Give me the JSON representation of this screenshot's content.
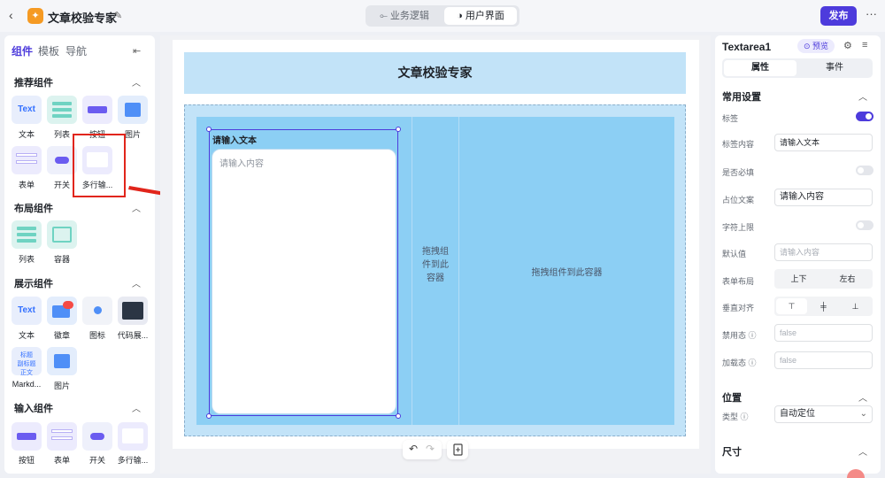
{
  "header": {
    "back_icon": "chevron-left-icon",
    "title": "文章校验专家",
    "modes": [
      "业务逻辑",
      "用户界面"
    ],
    "active_mode": "用户界面",
    "publish_label": "发布",
    "more_icon": "more-icon"
  },
  "left_panel": {
    "tabs": [
      "组件",
      "模板",
      "导航"
    ],
    "active_tab": "组件",
    "sections": {
      "recommended": {
        "title": "推荐组件",
        "items": [
          "文本",
          "列表",
          "按钮",
          "图片",
          "表单",
          "开关",
          "多行输..."
        ]
      },
      "layout": {
        "title": "布局组件",
        "items": [
          "列表",
          "容器"
        ]
      },
      "display": {
        "title": "展示组件",
        "items": [
          "文本",
          "徽章",
          "图标",
          "代码展...",
          "Markd...",
          "图片"
        ]
      },
      "input": {
        "title": "输入组件",
        "items": [
          "按钮",
          "表单",
          "开关",
          "多行输..."
        ]
      }
    },
    "tile_text": {
      "text": "Text",
      "badge": "99",
      "md": "标题\n副标题\n正文内容"
    }
  },
  "canvas": {
    "page_title": "文章校验专家",
    "textarea_label": "请输入文本",
    "textarea_placeholder": "请输入内容",
    "drop_hint_narrow": "拖拽组件到此容器",
    "drop_hint_wide": "拖拽组件到此容器"
  },
  "right_panel": {
    "component_name": "Textarea1",
    "preview_label": "预览",
    "tabs": [
      "属性",
      "事件"
    ],
    "active_tab": "属性",
    "sec_common": "常用设置",
    "labels": {
      "label": "标签",
      "label_content": "标签内容",
      "required": "是否必填",
      "placeholder": "占位文案",
      "maxlength": "字符上限",
      "default": "默认值",
      "form_layout": "表单布局",
      "v_align": "垂直对齐",
      "disabled": "禁用态",
      "loading": "加载态"
    },
    "values": {
      "label_content": "请输入文本",
      "placeholder": "请输入内容",
      "default_placeholder": "请输入内容",
      "disabled": "false",
      "loading": "false"
    },
    "form_layout_options": [
      "上下",
      "左右"
    ],
    "label_on": true,
    "required_on": false,
    "maxlength_on": false,
    "sec_position": "位置",
    "type_label": "类型",
    "type_value": "自动定位",
    "sec_size": "尺寸"
  }
}
